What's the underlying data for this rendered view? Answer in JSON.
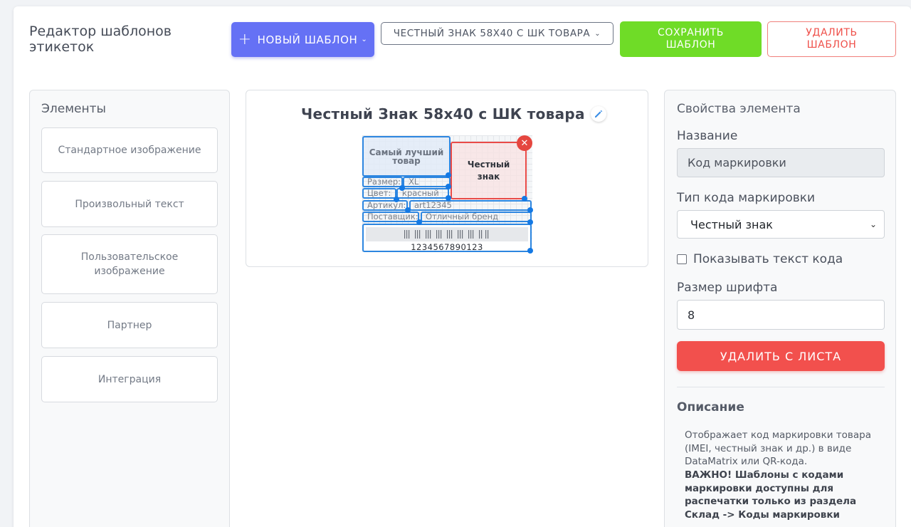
{
  "header": {
    "title": "Редактор шаблонов этикеток",
    "new_template_label": "НОВЫЙ ШАБЛОН",
    "template_select_value": "ЧЕСТНЫЙ ЗНАК 58Х40 С ШК ТОВАРА",
    "save_label": "СОХРАНИТЬ ШАБЛОН",
    "delete_label": "УДАЛИТЬ ШАБЛОН"
  },
  "elements_panel": {
    "title": "Элементы",
    "items": [
      {
        "label": "Стандартное изображение"
      },
      {
        "label": "Произвольный текст"
      },
      {
        "label": "Пользовательское изображение"
      },
      {
        "label": "Партнер"
      },
      {
        "label": "Интеграция"
      }
    ]
  },
  "canvas": {
    "template_title": "Честный Знак 58х40 с ШК товара",
    "product_name": "Самый лучший товар",
    "marking_code_label": "Честный знак",
    "size_label": "Размер:",
    "size_value": "XL",
    "color_label": "Цвет:",
    "color_value": "красный",
    "article_label": "Артикул:",
    "article_value": "art12345",
    "supplier_label": "Поставщик:",
    "supplier_value": "Отличный бренд",
    "barcode_number": "1234567890123"
  },
  "properties_panel": {
    "title": "Свойства элемента",
    "name_label": "Название",
    "name_value": "Код маркировки",
    "code_type_label": "Тип кода маркировки",
    "code_type_value": "Честный знак",
    "show_text_label": "Показывать текст кода",
    "show_text_checked": false,
    "font_size_label": "Размер шрифта",
    "font_size_value": "8",
    "remove_label": "УДАЛИТЬ С ЛИСТА",
    "description_title": "Описание",
    "description_text": "Отображает код маркировки товара (IMEI, честный знак и др.) в виде DataMatrix или QR-кода.",
    "description_warning": "ВАЖНО! Шаблоны с кодами маркировки доступны для распечатки только из раздела Склад -> Коды маркировки"
  },
  "colors": {
    "primary": "#6571f5",
    "success": "#6fdc27",
    "danger": "#f2504d",
    "selection": "#2d86e0"
  }
}
